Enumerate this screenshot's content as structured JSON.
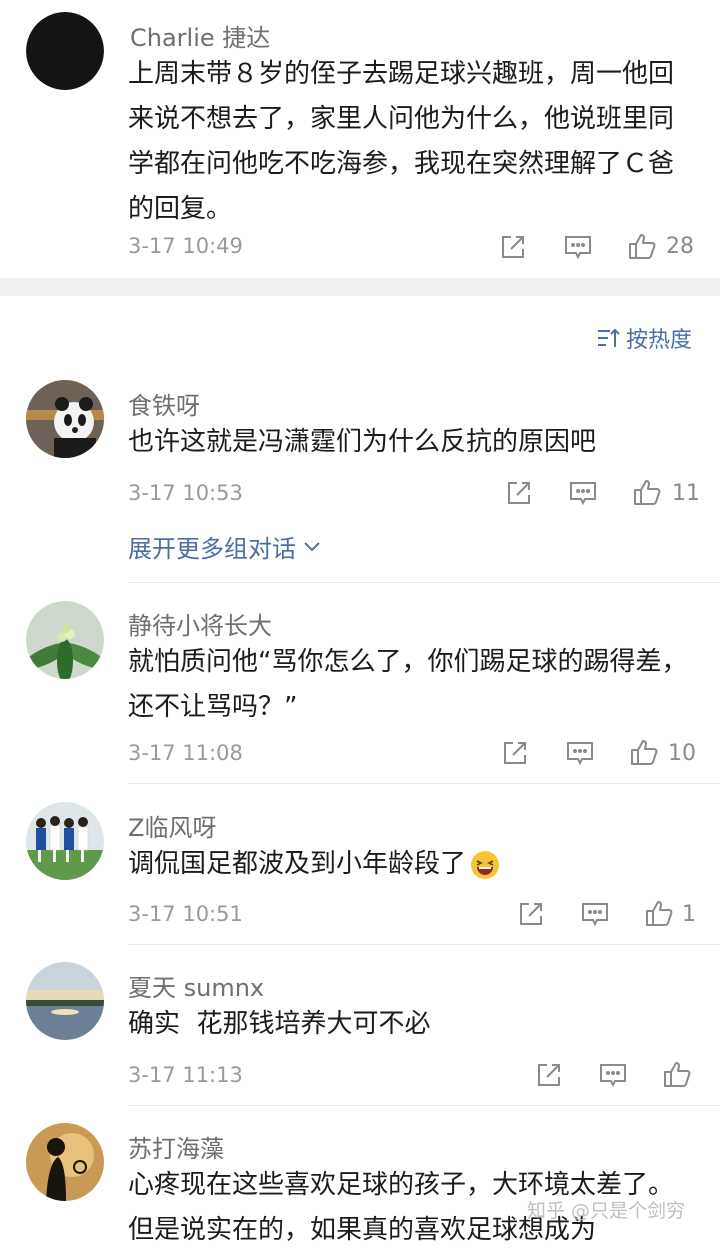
{
  "top_comment": {
    "name": "Charlie 捷达",
    "text": "上周末带８岁的侄子去踢足球兴趣班，周一他回来说不想去了，家里人问他为什么，他说班里同学都在问他吃不吃海参，我现在突然理解了Ｃ爸的回复。",
    "time": "3-17 10:49",
    "likes": "28"
  },
  "sort_label": "按热度",
  "expand_label": "展开更多组对话",
  "comments": [
    {
      "name": "食铁呀",
      "text": "也许这就是冯潇霆们为什么反抗的原因吧",
      "time": "3-17 10:53",
      "likes": "11"
    },
    {
      "name": "静待小将长大",
      "text": "就怕质问他“骂你怎么了，你们踢足球的踢得差，还不让骂吗？”",
      "time": "3-17 11:08",
      "likes": "10"
    },
    {
      "name": "Z临风呀",
      "text": "调侃国足都波及到小年龄段了",
      "time": "3-17 10:51",
      "likes": "1"
    },
    {
      "name": "夏天 sumnx",
      "text": "确实  花那钱培养大可不必",
      "time": "3-17 11:13",
      "likes": ""
    },
    {
      "name": "苏打海藻",
      "text": "心疼现在这些喜欢足球的孩子，大环境太差了。但是说实在的，如果真的喜欢足球想成为"
    }
  ],
  "watermark": "知乎 @只是个剑穷",
  "icons": {
    "share": "share-icon",
    "reply": "reply-icon",
    "like": "thumbs-up-icon",
    "sort": "sort-icon",
    "chevron": "chevron-down-icon",
    "emoji": "laughing-emoji-icon"
  },
  "colors": {
    "link": "#4a6fa5",
    "meta": "#9a9a9a",
    "name": "#6f6f6f",
    "divider": "#f0f0f2"
  }
}
